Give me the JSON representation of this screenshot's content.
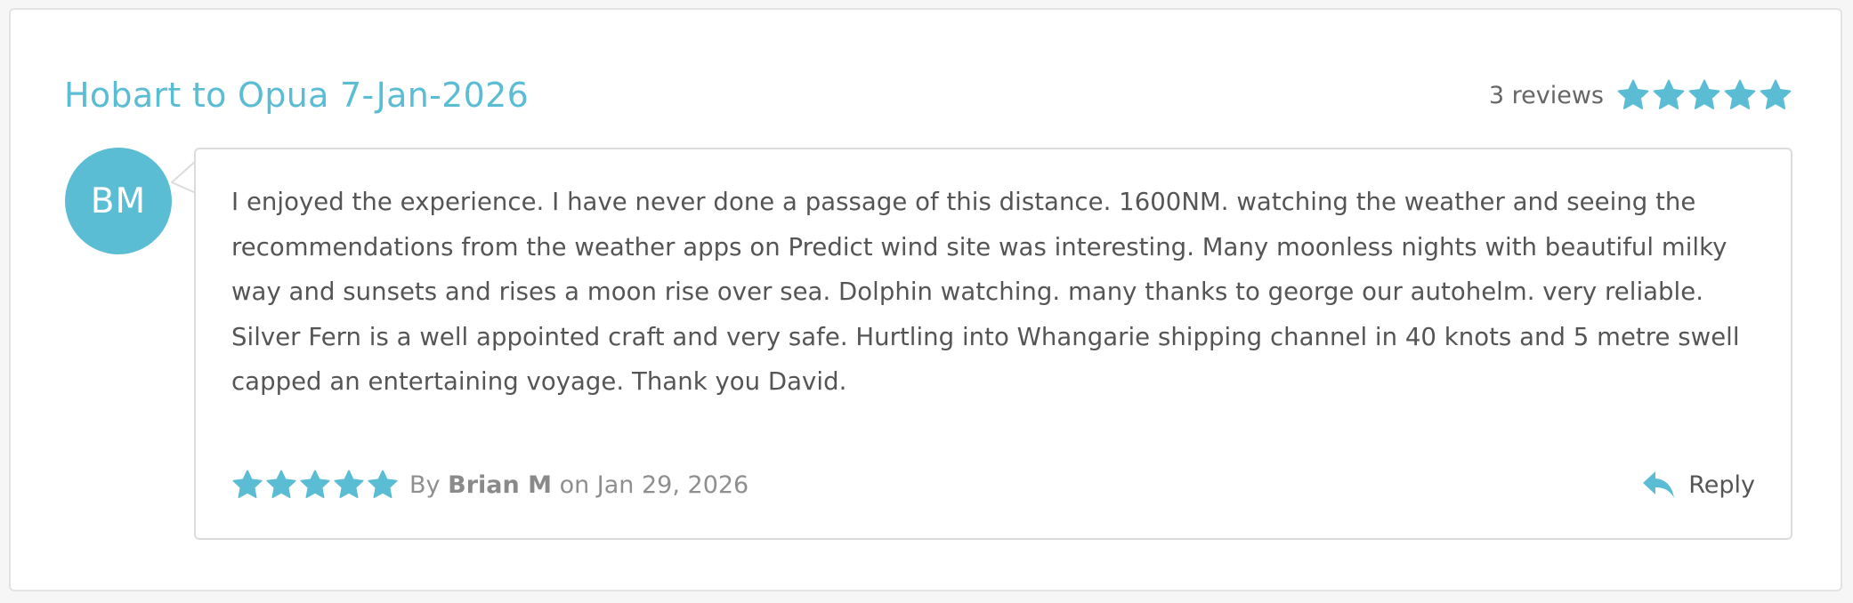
{
  "review_widget": {
    "title": "Hobart to Opua 7-Jan-2026",
    "review_count": "3 reviews",
    "overall_rating": 5,
    "max_rating": 5,
    "accent_color": "#5bbdd3"
  },
  "review": {
    "avatar_initials": "BM",
    "text": "I enjoyed the experience. I have never done a passage of this distance. 1600NM. watching the weather and seeing the recommendations from the weather apps on Predict wind site was interesting. Many moonless nights with beautiful milky way and sunsets and rises a moon rise over sea. Dolphin watching. many thanks to george our autohelm. very reliable. Silver Fern is a well appointed craft and very safe. Hurtling into Whangarie shipping channel in 40 knots and 5 metre swell capped an entertaining voyage. Thank you David.",
    "rating": 5,
    "by_label": "By",
    "author": "Brian M",
    "on_label": "on",
    "date": "Jan 29, 2026",
    "reply_label": "Reply",
    "reply_icon": "reply-arrow-icon"
  }
}
